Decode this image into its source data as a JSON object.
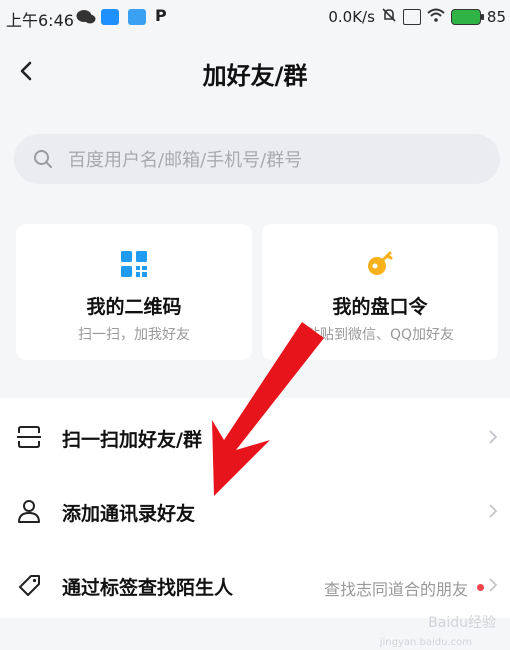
{
  "status_bar": {
    "time": "上午6:46",
    "net_speed": "0.0K/s",
    "battery": "85"
  },
  "header": {
    "title": "加好友/群",
    "back_icon": "chevron-left-icon"
  },
  "search": {
    "placeholder": "百度用户名/邮箱/手机号/群号",
    "icon": "search-icon"
  },
  "cards": [
    {
      "title": "我的二维码",
      "subtitle": "扫一扫，加我好友",
      "icon": "qr-code-icon",
      "color": "#1f9bf0"
    },
    {
      "title": "我的盘口令",
      "subtitle": "粘贴到微信、QQ加好友",
      "icon": "key-icon",
      "color": "#f7b21b"
    }
  ],
  "list": [
    {
      "label": "扫一扫加好友/群",
      "icon": "scan-icon",
      "hint": ""
    },
    {
      "label": "添加通讯录好友",
      "icon": "contact-icon",
      "hint": ""
    },
    {
      "label": "通过标签查找陌生人",
      "icon": "tag-icon",
      "hint": "查找志同道合的朋友",
      "badge_color": "#f0434b"
    }
  ],
  "watermark": {
    "brand": "Baidu经验",
    "url": "jingyan.baidu.com"
  },
  "colors": {
    "background": "#f5f6f8",
    "annotation_arrow": "#e8141b"
  }
}
